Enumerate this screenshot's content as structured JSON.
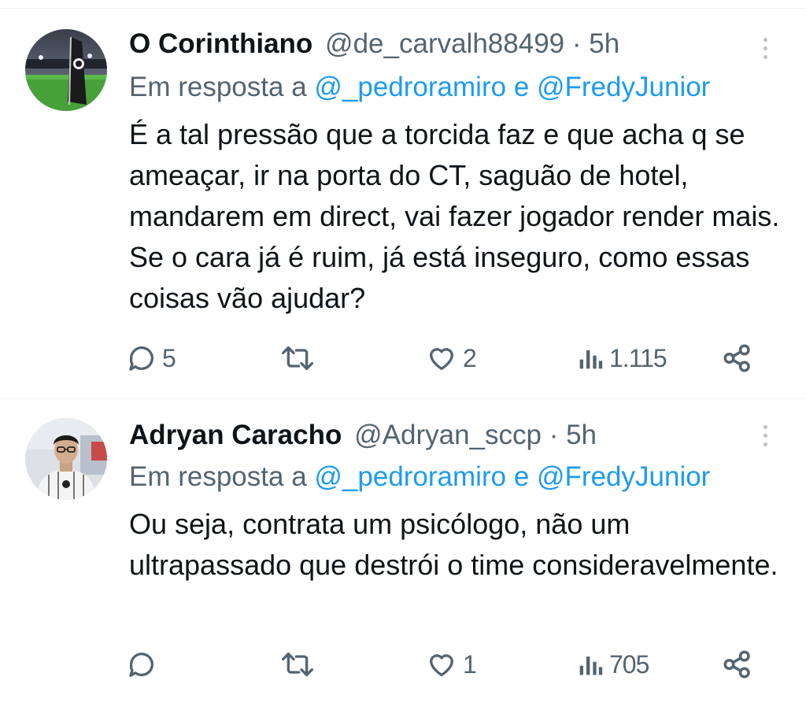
{
  "tweets": [
    {
      "name": "O Corinthiano",
      "handle": "@de_carvalh88499",
      "separator": "·",
      "time": "5h",
      "reply_prefix": "Em resposta a",
      "reply_mention1": "@_pedroramiro",
      "reply_and": "e",
      "reply_mention2": "@FredyJunior",
      "text": "É a tal pressão que a torcida faz e que acha q se ameaçar, ir na porta do CT, saguão de hotel, mandarem em direct, vai fazer jogador render mais. Se o cara já é ruim, já está inseguro, como essas coisas vão ajudar?",
      "replies": "5",
      "retweets": "",
      "likes": "2",
      "views": "1.115"
    },
    {
      "name": "Adryan Caracho",
      "handle": "@Adryan_sccp",
      "separator": "·",
      "time": "5h",
      "reply_prefix": "Em resposta a",
      "reply_mention1": "@_pedroramiro",
      "reply_and": "e",
      "reply_mention2": "@FredyJunior",
      "text": "Ou seja, contrata um psicólogo, não um ultrapassado que destrói o time consideravelmente.",
      "replies": "",
      "retweets": "",
      "likes": "1",
      "views": "705"
    }
  ],
  "colors": {
    "text": "#0f1419",
    "secondary": "#536471",
    "link": "#1d9bf0",
    "divider": "#eff3f4"
  },
  "icons": [
    "reply-icon",
    "retweet-icon",
    "like-icon",
    "views-icon",
    "share-icon",
    "more-icon"
  ]
}
